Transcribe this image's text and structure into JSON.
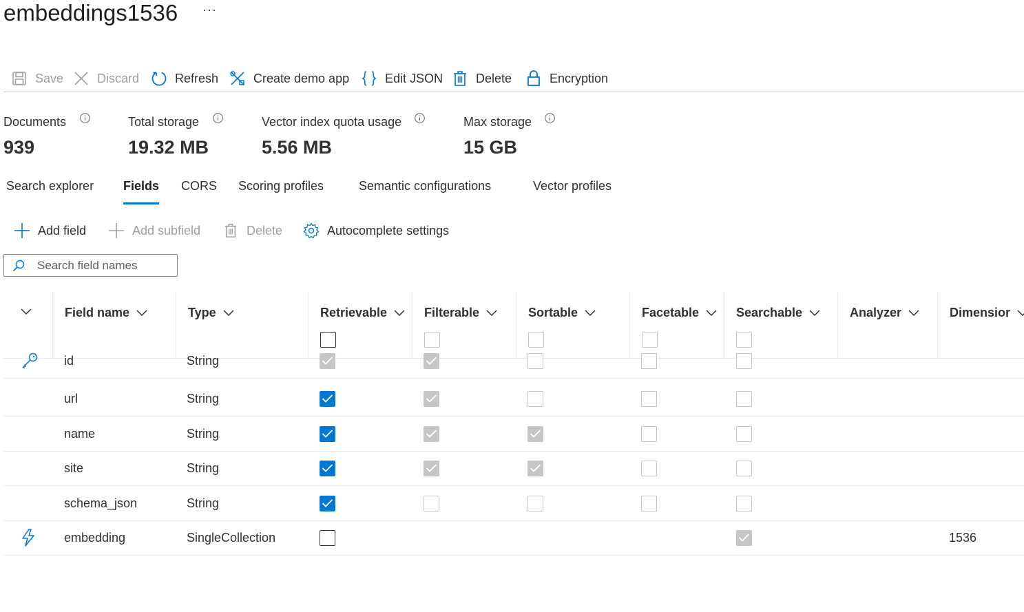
{
  "page": {
    "title": "embeddings1536",
    "more": "···"
  },
  "toolbar": {
    "save": "Save",
    "discard": "Discard",
    "refresh": "Refresh",
    "create_demo_app": "Create demo app",
    "edit_json": "Edit JSON",
    "delete": "Delete",
    "encryption": "Encryption"
  },
  "stats": [
    {
      "label": "Documents",
      "value": "939"
    },
    {
      "label": "Total storage",
      "value": "19.32 MB"
    },
    {
      "label": "Vector index quota usage",
      "value": "5.56 MB"
    },
    {
      "label": "Max storage",
      "value": "15 GB"
    }
  ],
  "tabs": [
    {
      "label": "Search explorer",
      "active": false
    },
    {
      "label": "Fields",
      "active": true
    },
    {
      "label": "CORS",
      "active": false
    },
    {
      "label": "Scoring profiles",
      "active": false
    },
    {
      "label": "Semantic configurations",
      "active": false
    },
    {
      "label": "Vector profiles",
      "active": false
    }
  ],
  "field_toolbar": {
    "add_field": "Add field",
    "add_subfield": "Add subfield",
    "delete": "Delete",
    "autocomplete": "Autocomplete settings"
  },
  "search": {
    "placeholder": "Search field names",
    "value": ""
  },
  "columns": {
    "field_name": "Field name",
    "type": "Type",
    "retrievable": "Retrievable",
    "filterable": "Filterable",
    "sortable": "Sortable",
    "facetable": "Facetable",
    "searchable": "Searchable",
    "analyzer": "Analyzer",
    "dimensions": "Dimensior"
  },
  "colors": {
    "accent": "#0078d4",
    "disabled_check": "#c8c6c4",
    "border": "#edebe9"
  },
  "rows": [
    {
      "icon": "key-icon",
      "name": "id",
      "type": "String",
      "retrievable": "checked-disabled",
      "filterable": "checked-disabled",
      "sortable": "unchecked-disabled",
      "facetable": "unchecked-disabled",
      "searchable": "unchecked-disabled",
      "analyzer": "",
      "dimensions": ""
    },
    {
      "icon": "",
      "name": "url",
      "type": "String",
      "retrievable": "checked",
      "filterable": "checked-disabled",
      "sortable": "unchecked-disabled",
      "facetable": "unchecked-disabled",
      "searchable": "unchecked-disabled",
      "analyzer": "",
      "dimensions": ""
    },
    {
      "icon": "",
      "name": "name",
      "type": "String",
      "retrievable": "checked",
      "filterable": "checked-disabled",
      "sortable": "checked-disabled",
      "facetable": "unchecked-disabled",
      "searchable": "unchecked-disabled",
      "analyzer": "",
      "dimensions": ""
    },
    {
      "icon": "",
      "name": "site",
      "type": "String",
      "retrievable": "checked",
      "filterable": "checked-disabled",
      "sortable": "checked-disabled",
      "facetable": "unchecked-disabled",
      "searchable": "unchecked-disabled",
      "analyzer": "",
      "dimensions": ""
    },
    {
      "icon": "",
      "name": "schema_json",
      "type": "String",
      "retrievable": "checked",
      "filterable": "unchecked-disabled",
      "sortable": "unchecked-disabled",
      "facetable": "unchecked-disabled",
      "searchable": "unchecked-disabled",
      "analyzer": "",
      "dimensions": ""
    },
    {
      "icon": "lightning-icon",
      "name": "embedding",
      "type": "SingleCollection",
      "retrievable": "unchecked",
      "filterable": "none",
      "sortable": "none",
      "facetable": "none",
      "searchable": "checked-disabled",
      "analyzer": "",
      "dimensions": "1536"
    }
  ]
}
